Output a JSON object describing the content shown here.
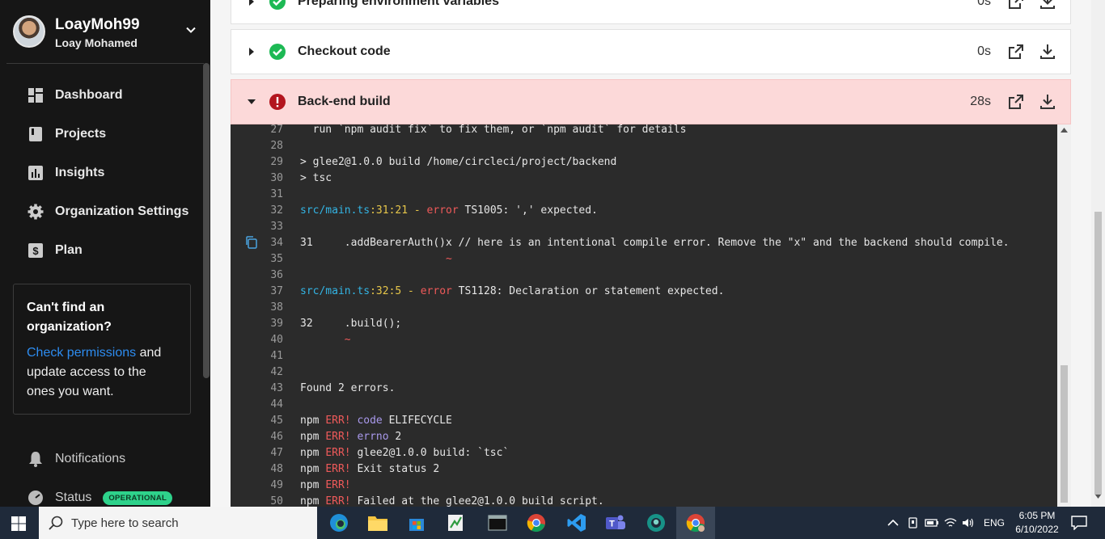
{
  "sidebar": {
    "username": "LoayMoh99",
    "realname": "Loay Mohamed",
    "nav": [
      "Dashboard",
      "Projects",
      "Insights",
      "Organization Settings",
      "Plan"
    ],
    "help": {
      "title": "Can't find an organization?",
      "link": "Check permissions",
      "text": " and update access to the ones you want."
    },
    "notifications": "Notifications",
    "status_label": "Status",
    "status_badge": "OPERATIONAL"
  },
  "steps": [
    {
      "name": "Preparing environment variables",
      "duration": "0s",
      "state": "success"
    },
    {
      "name": "Checkout code",
      "duration": "0s",
      "state": "success"
    },
    {
      "name": "Back-end build",
      "duration": "28s",
      "state": "failed"
    }
  ],
  "console": {
    "lines": [
      {
        "n": "27",
        "t": "  run `npm audit fix` to fix them, or `npm audit` for details"
      },
      {
        "n": "28",
        "t": ""
      },
      {
        "n": "29",
        "t": "> glee2@1.0.0 build /home/circleci/project/backend"
      },
      {
        "n": "30",
        "t": "> tsc"
      },
      {
        "n": "31",
        "t": ""
      },
      {
        "n": "32",
        "t": "src/main.ts:31:21 - error TS1005: ',' expected."
      },
      {
        "n": "33",
        "t": ""
      },
      {
        "n": "34",
        "t": "31     .addBearerAuth()x // here is an intentional compile error. Remove the \"x\" and the backend should compile."
      },
      {
        "n": "35",
        "t": "                       ~"
      },
      {
        "n": "36",
        "t": ""
      },
      {
        "n": "37",
        "t": "src/main.ts:32:5 - error TS1128: Declaration or statement expected."
      },
      {
        "n": "38",
        "t": ""
      },
      {
        "n": "39",
        "t": "32     .build();"
      },
      {
        "n": "40",
        "t": "       ~"
      },
      {
        "n": "41",
        "t": ""
      },
      {
        "n": "42",
        "t": ""
      },
      {
        "n": "43",
        "t": "Found 2 errors."
      },
      {
        "n": "44",
        "t": ""
      },
      {
        "n": "45",
        "t": "npm ERR! code ELIFECYCLE"
      },
      {
        "n": "46",
        "t": "npm ERR! errno 2"
      },
      {
        "n": "47",
        "t": "npm ERR! glee2@1.0.0 build: `tsc`"
      },
      {
        "n": "48",
        "t": "npm ERR! Exit status 2"
      },
      {
        "n": "49",
        "t": "npm ERR!"
      },
      {
        "n": "50",
        "t": "npm ERR! Failed at the glee2@1.0.0 build script."
      }
    ]
  },
  "taskbar": {
    "search_placeholder": "Type here to search",
    "language": "ENG",
    "time": "6:05 PM",
    "date": "6/10/2022"
  },
  "colors": {
    "success": "#1db954",
    "failed": "#b3151e",
    "sidebar_bg": "#161616",
    "status_green": "#2ed28b"
  }
}
